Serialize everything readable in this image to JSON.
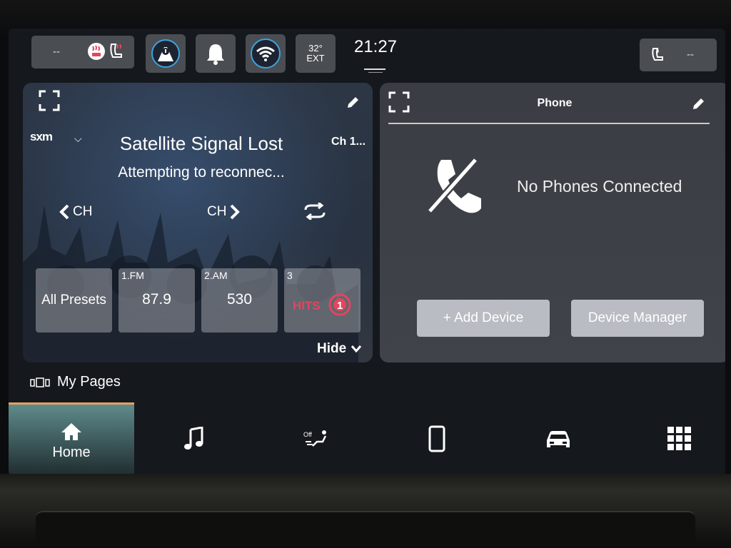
{
  "status_bar": {
    "left_seat_value": "--",
    "right_seat_value": "--",
    "temperature": "32°",
    "temperature_label": "EXT",
    "time": "21:27"
  },
  "radio": {
    "source": "sxm",
    "title": "Satellite Signal Lost",
    "subtitle": "Attempting to reconnec...",
    "channel": "Ch 1...",
    "ch_prev": "CH",
    "ch_next": "CH",
    "presets": [
      {
        "number": "",
        "value": "All Presets"
      },
      {
        "number": "1.FM",
        "value": "87.9"
      },
      {
        "number": "2.AM",
        "value": "530"
      },
      {
        "number": "3",
        "value": "HITS1"
      }
    ],
    "hide_label": "Hide"
  },
  "phone": {
    "title": "Phone",
    "message": "No Phones Connected",
    "add_device": "+ Add Device",
    "device_manager": "Device Manager"
  },
  "my_pages": "My Pages",
  "nav": {
    "home": "Home",
    "climate_off": "Off"
  },
  "colors": {
    "accent_orange": "#e5a060",
    "home_teal": "#5f8b8c",
    "panel_bg": "#3a3e46",
    "hits_pink": "#e2465f"
  }
}
